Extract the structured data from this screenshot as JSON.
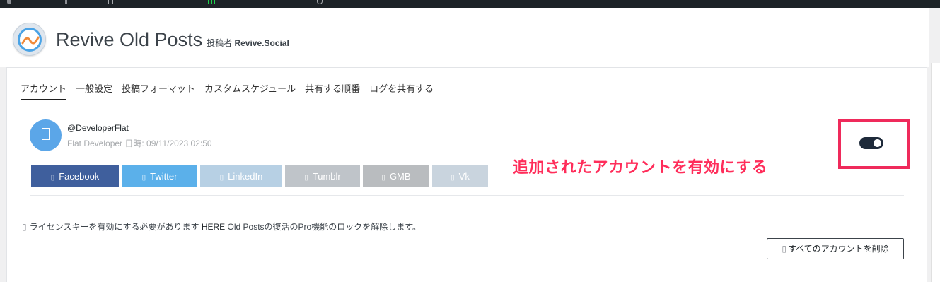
{
  "header": {
    "plugin_name": "Revive Old Posts",
    "by_prefix": "投稿者",
    "by_author": "Revive.Social"
  },
  "tabs": [
    {
      "label": "アカウント",
      "active": true
    },
    {
      "label": "一般設定"
    },
    {
      "label": "投稿フォーマット"
    },
    {
      "label": "カスタムスケジュール"
    },
    {
      "label": "共有する順番"
    },
    {
      "label": "ログを共有する"
    }
  ],
  "account": {
    "handle": "@DeveloperFlat",
    "meta": "Flat Developer 日時: 09/11/2023 02:50",
    "avatar_icon": "image-placeholder-icon",
    "enabled": true
  },
  "services": [
    {
      "label": "Facebook",
      "icon": "facebook-icon",
      "color": "#3f5f9d"
    },
    {
      "label": "Twitter",
      "icon": "twitter-icon",
      "color": "#5bb0ea"
    },
    {
      "label": "LinkedIn",
      "icon": "linkedin-icon",
      "color": "#b7d0e4"
    },
    {
      "label": "Tumblr",
      "icon": "tumblr-icon",
      "color": "#bfc4c9"
    },
    {
      "label": "GMB",
      "icon": "google-my-business-icon",
      "color": "#b9bcbf"
    },
    {
      "label": "Vk",
      "icon": "vk-icon",
      "color": "#c9d4de"
    }
  ],
  "annotation": {
    "text": "追加されたアカウントを有効にする",
    "color": "#ef2a5b"
  },
  "notice": {
    "icon": "lock-icon",
    "before": "ライセンスキーを有効にする必要があります",
    "link": "HERE",
    "after": "Old Postsの復活のPro機能のロックを解除します。"
  },
  "actions": {
    "remove_all_label": "すべてのアカウントを削除",
    "remove_all_icon": "trash-icon"
  }
}
